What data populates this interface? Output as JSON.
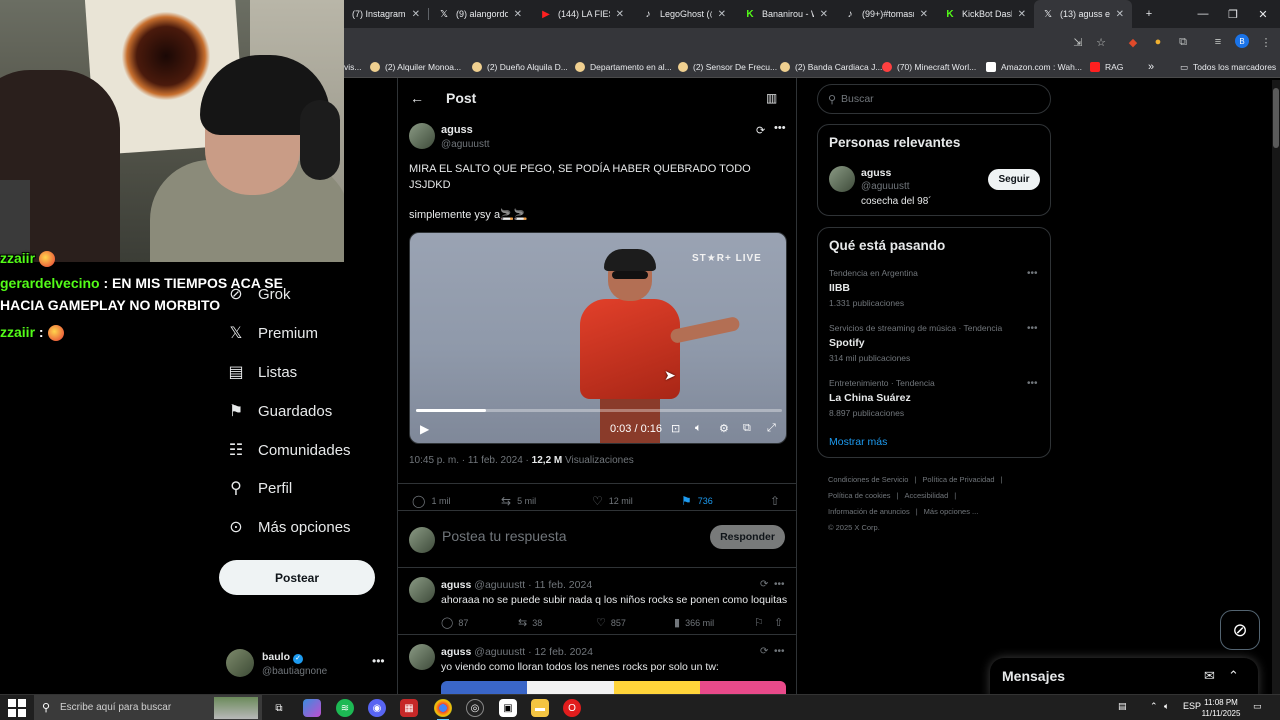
{
  "browser": {
    "tabs": [
      {
        "title": "(7) Instagram",
        "icon": "instagram-icon",
        "active": false
      },
      {
        "title": "(9) alangordo(",
        "icon": "x-icon",
        "active": false
      },
      {
        "title": "(144) LA FIESTA",
        "icon": "youtube-icon",
        "active": false
      },
      {
        "title": "LegoGhost (@l",
        "icon": "tiktok-icon",
        "active": false
      },
      {
        "title": "Bananirou - W",
        "icon": "kick-icon",
        "active": false
      },
      {
        "title": "(99+)#tomasm",
        "icon": "tiktok-icon",
        "active": false
      },
      {
        "title": "KickBot Dashb",
        "icon": "kick-icon",
        "active": false
      },
      {
        "title": "(13) aguss en",
        "icon": "x-icon",
        "active": true
      }
    ],
    "new_tab_label": "+",
    "profile_initial": "B",
    "bookmarks": [
      {
        "label": "vis...",
        "color": "#888888"
      },
      {
        "label": "(2) Alquiler Monoa...",
        "color": "#f0d090"
      },
      {
        "label": "(2) Dueño Alquila D...",
        "color": "#f0d090"
      },
      {
        "label": "Departamento en al...",
        "color": "#f0d090"
      },
      {
        "label": "(2) Sensor De Frecu...",
        "color": "#f0d090"
      },
      {
        "label": "(2) Banda Cardiaca J...",
        "color": "#f0d090"
      },
      {
        "label": "(70) Minecraft Worl...",
        "color": "#ff4040"
      },
      {
        "label": "Amazon.com : Wah...",
        "color": "#ffffff"
      },
      {
        "label": "RAG",
        "color": "#ff2020"
      }
    ],
    "bookmarks_overflow": "»",
    "all_bookmarks_label": "Todos los marcadores"
  },
  "chat": [
    {
      "user": "zzaiir",
      "message": "",
      "emote": true
    },
    {
      "user": "gerardelvecino",
      "message": ": EN MIS TIEMPOS ACA SE",
      "emote": false
    },
    {
      "user": "",
      "message": "HACIA GAMEPLAY NO MORBITO",
      "emote": false
    },
    {
      "user": "zzaiir",
      "message": ":",
      "emote": true
    }
  ],
  "nav": {
    "items": [
      {
        "label": "Grok",
        "icon": "grok-icon"
      },
      {
        "label": "Premium",
        "icon": "x-logo-icon"
      },
      {
        "label": "Listas",
        "icon": "list-icon"
      },
      {
        "label": "Guardados",
        "icon": "bookmark-icon"
      },
      {
        "label": "Comunidades",
        "icon": "communities-icon"
      },
      {
        "label": "Perfil",
        "icon": "profile-icon"
      },
      {
        "label": "Más opciones",
        "icon": "more-options-icon"
      }
    ],
    "post_button": "Postear",
    "account": {
      "name": "baulo",
      "handle": "@bautiagnone",
      "verified": true
    }
  },
  "post": {
    "header_title": "Post",
    "author_name": "aguss",
    "author_handle": "@aguuustt",
    "text": "MIRA EL SALTO QUE PEGO, SE PODÍA HABER QUEBRADO TODO JSJDKD",
    "text2": "simplemente ysy a🚬🚬",
    "video": {
      "watermark": "ST★R+ LIVE",
      "time": "0:03 / 0:16",
      "progress_fraction": 0.19
    },
    "timestamp": "10:45 p. m. · 11 feb. 2024 ·",
    "views_count": "12,2 M",
    "views_label": "Visualizaciones",
    "replies": "1 mil",
    "reposts": "5 mil",
    "likes": "12 mil",
    "bookmarks": "736",
    "reply_placeholder": "Postea tu respuesta",
    "reply_button": "Responder"
  },
  "replies": [
    {
      "name": "aguss",
      "meta": "@aguuustt · 11 feb. 2024",
      "text": "ahoraaa no se puede subir nada q los niños rocks se ponen como loquitas",
      "replies": "87",
      "reposts": "38",
      "likes": "857",
      "views": "366 mil"
    },
    {
      "name": "aguss",
      "meta": "@aguuustt · 12 feb. 2024",
      "text": "yo viendo como lloran todos los nenes rocks por solo un tw:"
    }
  ],
  "sidebar": {
    "search_placeholder": "Buscar",
    "relevant_title": "Personas relevantes",
    "relevant_person": {
      "name": "aguss",
      "handle": "@aguuustt",
      "bio": "cosecha del 98´",
      "follow_label": "Seguir"
    },
    "trending_title": "Qué está pasando",
    "trends": [
      {
        "category": "Tendencia en Argentina",
        "name": "IIBB",
        "count": "1.331 publicaciones"
      },
      {
        "category": "Servicios de streaming de música · Tendencia",
        "name": "Spotify",
        "count": "314 mil publicaciones"
      },
      {
        "category": "Entretenimiento · Tendencia",
        "name": "La China Suárez",
        "count": "8.897 publicaciones"
      }
    ],
    "show_more": "Mostrar más",
    "footer_links": [
      "Condiciones de Servicio",
      "|",
      "Política de Privacidad",
      "|",
      "Política de cookies",
      "|",
      "Accesibilidad",
      "|",
      "Información de anuncios",
      "|",
      "Más opciones ...",
      "© 2025 X Corp."
    ],
    "messages_title": "Mensajes"
  },
  "taskbar": {
    "search_placeholder": "Escribe aquí para buscar",
    "language": "ESP",
    "time": "11:08 PM",
    "date": "11/11/2025"
  },
  "colors": {
    "accent": "#1d9bf0",
    "background": "#000000",
    "kick_green": "#53fc18"
  }
}
